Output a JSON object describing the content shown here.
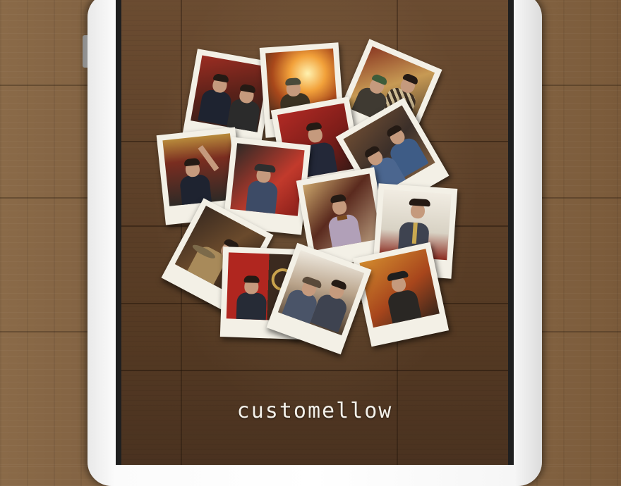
{
  "app": {
    "title": "customellow"
  },
  "photos": [
    {
      "name": "photo-men-in-suits"
    },
    {
      "name": "photo-fire-burst"
    },
    {
      "name": "photo-checked-scarf"
    },
    {
      "name": "photo-man-red-wall"
    },
    {
      "name": "photo-arm-raised"
    },
    {
      "name": "photo-cap-driver"
    },
    {
      "name": "photo-denim-shirts"
    },
    {
      "name": "photo-bow-tie"
    },
    {
      "name": "photo-vest-tie"
    },
    {
      "name": "photo-hat-collar"
    },
    {
      "name": "photo-red-doorway"
    },
    {
      "name": "photo-vest-group"
    },
    {
      "name": "photo-cap-portrait"
    }
  ],
  "colors": {
    "desk": "#7c5c3d",
    "screen_wood": "#5e4129",
    "polaroid": "#f3f0e6",
    "title": "#f4f1ea"
  }
}
